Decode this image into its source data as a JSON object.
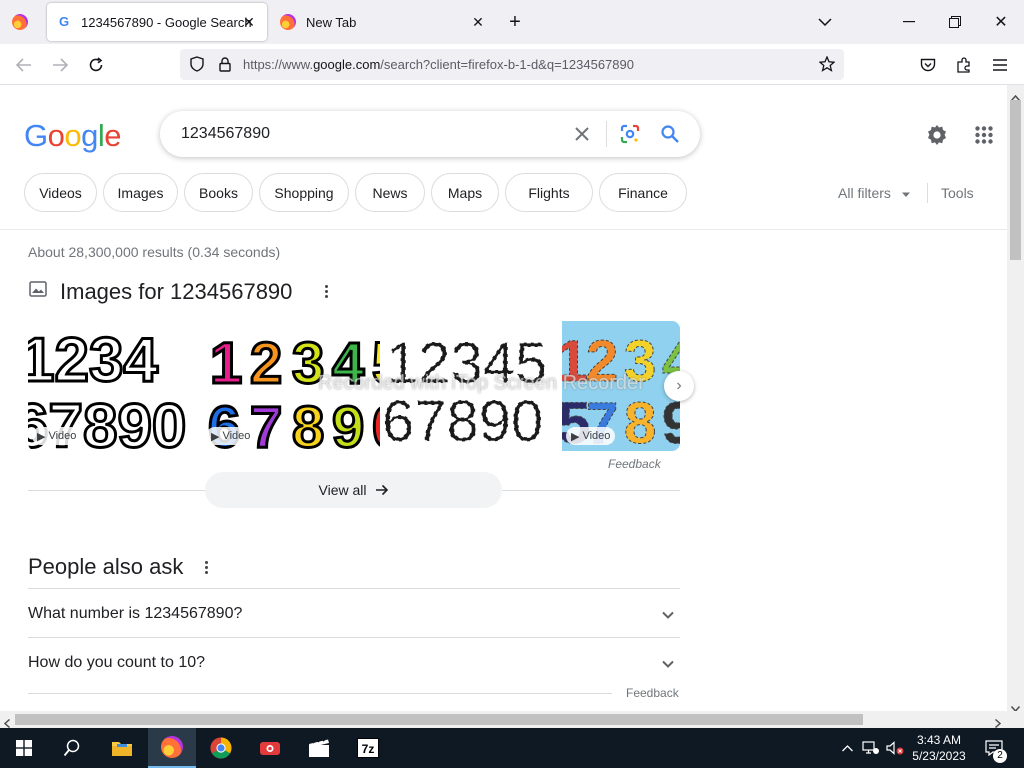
{
  "browser": {
    "tabs": [
      {
        "title": "1234567890 - Google Search",
        "active": true,
        "favicon": "google-g-icon"
      },
      {
        "title": "New Tab",
        "active": false,
        "favicon": "firefox-icon"
      }
    ],
    "url_prefix": "https://www.",
    "url_domain": "google.com",
    "url_rest": "/search?client=firefox-b-1-d&q=1234567890"
  },
  "google": {
    "logo": [
      "G",
      "o",
      "o",
      "g",
      "l",
      "e"
    ],
    "logo_colors": [
      "#4285f4",
      "#ea4335",
      "#fbbc05",
      "#4285f4",
      "#34a853",
      "#ea4335"
    ],
    "query": "1234567890",
    "chips": [
      "Videos",
      "Images",
      "Books",
      "Shopping",
      "News",
      "Maps",
      "Flights",
      "Finance"
    ],
    "all_filters": "All filters",
    "tools": "Tools",
    "stats": "About 28,300,000 results (0.34 seconds)",
    "images_title": "Images for 1234567890",
    "video_label": "Video",
    "watermark": "Recorded with iTop Screen Recorder",
    "feedback": "Feedback",
    "view_all": "View all",
    "paa_title": "People also ask",
    "paa_questions": [
      "What number is 1234567890?",
      "How do you count to 10?"
    ]
  },
  "taskbar": {
    "time": "3:43 AM",
    "date": "5/23/2023",
    "notifications": "2"
  }
}
